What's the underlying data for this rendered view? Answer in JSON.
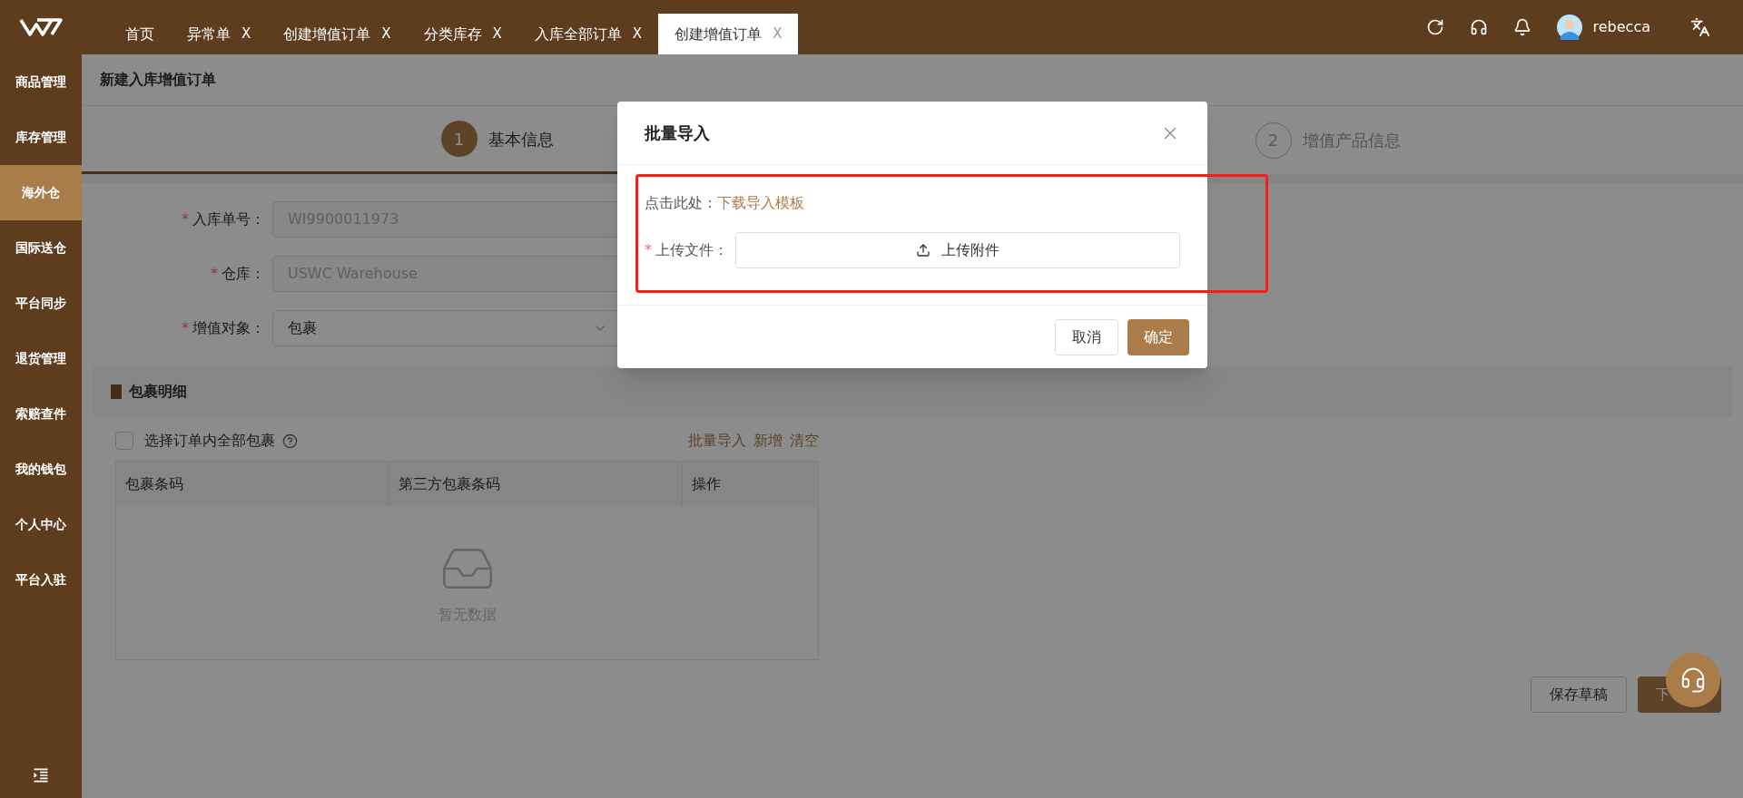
{
  "top_bar": {
    "tabs": [
      {
        "label": "首页",
        "selected": false
      },
      {
        "label": "异常单",
        "close_mark": "X",
        "selected": false
      },
      {
        "label": "创建增值订单",
        "close_mark": "X",
        "selected": false
      },
      {
        "label": "分类库存",
        "close_mark": "X",
        "selected": false
      },
      {
        "label": "入库全部订单",
        "close_mark": "X",
        "selected": false
      },
      {
        "label": "创建增值订单",
        "close_mark": "X",
        "selected": true
      }
    ],
    "username": "rebecca"
  },
  "sidebar": {
    "items": [
      {
        "label": "商品管理",
        "selected": false
      },
      {
        "label": "库存管理",
        "selected": false
      },
      {
        "label": "海外仓",
        "selected": true
      },
      {
        "label": "国际送仓",
        "selected": false
      },
      {
        "label": "平台同步",
        "selected": false
      },
      {
        "label": "退货管理",
        "selected": false
      },
      {
        "label": "索赔查件",
        "selected": false
      },
      {
        "label": "我的钱包",
        "selected": false
      },
      {
        "label": "个人中心",
        "selected": false
      },
      {
        "label": "平台入驻",
        "selected": false
      }
    ]
  },
  "page": {
    "title": "新建入库增值订单",
    "steps": [
      {
        "number": "1",
        "label": "基本信息",
        "selected": true
      },
      {
        "number": "2",
        "label": "增值产品信息",
        "selected": false
      }
    ],
    "form": [
      {
        "label": "入库单号：",
        "required_mark": "*",
        "kind": "input",
        "value": "WI9900011973",
        "disabled": true
      },
      {
        "label": "仓库：",
        "required_mark": "*",
        "kind": "input",
        "value": "USWC Warehouse",
        "disabled": true
      },
      {
        "label": "增值对象：",
        "required_mark": "*",
        "kind": "select",
        "value": "包裹",
        "disabled": false
      }
    ],
    "parcels": {
      "title": "包裹明细",
      "select_all": {
        "label": "选择订单内全部包裹",
        "checked": false
      },
      "actions": [
        "批量导入",
        "新增",
        "清空"
      ],
      "columns": [
        "包裹条码",
        "第三方包裹条码",
        "操作"
      ],
      "empty_text": "暂无数据"
    },
    "footer_buttons": [
      {
        "label": "保存草稿",
        "kind": "secondary"
      },
      {
        "label": "下",
        "kind": "primary"
      }
    ]
  },
  "dialog": {
    "title": "批量导入",
    "template_prompt": "点击此处：",
    "template_link": "下载导入模板",
    "upload_label": "上传文件：",
    "upload_required_mark": "*",
    "upload_button": "上传附件",
    "buttons": [
      {
        "label": "取消",
        "kind": "secondary"
      },
      {
        "label": "确定",
        "kind": "primary"
      }
    ]
  }
}
